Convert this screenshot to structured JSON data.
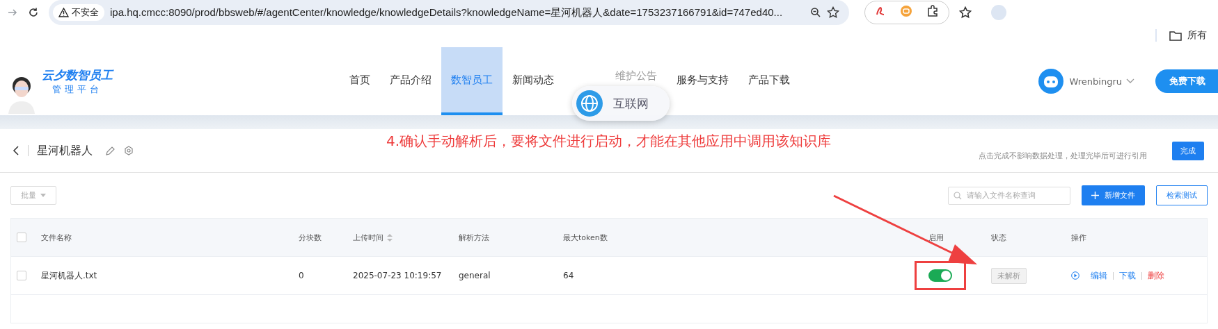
{
  "browser": {
    "security_label": "不安全",
    "url": "ipa.hq.cmcc:8090/prod/bbsweb/#/agentCenter/knowledge/knowledgeDetails?knowledgeName=星河机器人&date=1753237166791&id=747ed40...",
    "bookmark": "所有"
  },
  "site": {
    "logo_title": "云夕数智员工",
    "logo_subtitle": "管理平台",
    "nav": [
      {
        "label": "首页",
        "selected": false
      },
      {
        "label": "产品介绍",
        "selected": false
      },
      {
        "label": "数智员工",
        "selected": true
      },
      {
        "label": "新闻动态",
        "selected": false
      },
      {
        "label": "维护公告",
        "selected": false
      },
      {
        "label": "服务与支持",
        "selected": false
      },
      {
        "label": "产品下载",
        "selected": false
      }
    ],
    "user": "Wrenbingru",
    "download_button": "免费下载"
  },
  "overlay_badge": "互联网",
  "header": {
    "title": "星河机器人",
    "hint": "点击完成不影响数据处理，处理完毕后可进行引用",
    "done_button": "完成"
  },
  "annotation": "4.确认手动解析后，要将文件进行启动，才能在其他应用中调用该知识库",
  "toolbar": {
    "batch": "批量",
    "search_placeholder": "请输入文件名称查询",
    "add_button": "新增文件",
    "test_button": "检索测试"
  },
  "table": {
    "all_checked": false,
    "columns": [
      "文件名称",
      "分块数",
      "上传时间",
      "解析方法",
      "最大token数",
      "启用",
      "状态",
      "操作"
    ],
    "rows": [
      {
        "checked": false,
        "name": "星河机器人.txt",
        "chunks": "0",
        "time": "2025-07-23 10:19:57",
        "method": "general",
        "max_token": "64",
        "enabled": true,
        "status": "未解析",
        "actions": [
          {
            "label": "编辑",
            "kind": "normal"
          },
          {
            "label": "下载",
            "kind": "normal"
          },
          {
            "label": "删除",
            "kind": "danger"
          }
        ]
      }
    ]
  }
}
